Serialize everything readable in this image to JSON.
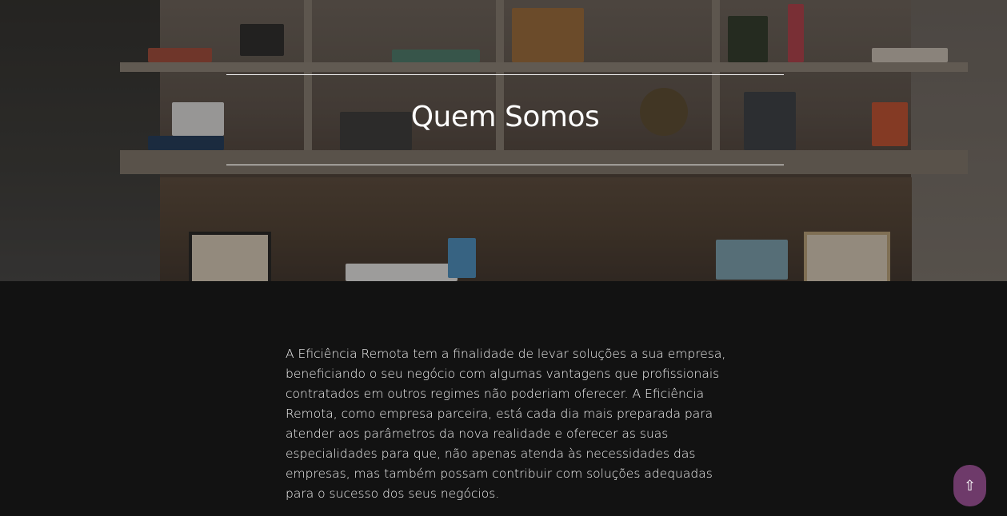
{
  "hero": {
    "title": "Quem Somos"
  },
  "about": {
    "paragraph": "A Eficiência Remota tem a finalidade de levar soluções a sua empresa, beneficiando o seu negócio com algumas vantagens que profissionais contratados em outros regimes não poderiam oferecer. A Eficiência Remota, como empresa parceira, está cada dia mais preparada para atender aos parâmetros da nova realidade e oferecer as suas especialidades para que, não apenas atenda às necessidades das empresas, mas também possam contribuir com soluções adequadas para o sucesso dos seus negócios."
  },
  "scroll_top": {
    "icon": "⇧",
    "icon_name": "arrow-up-icon"
  },
  "colors": {
    "background": "#121212",
    "accent": "#6e3a6a",
    "text": "#f0f0f0"
  }
}
